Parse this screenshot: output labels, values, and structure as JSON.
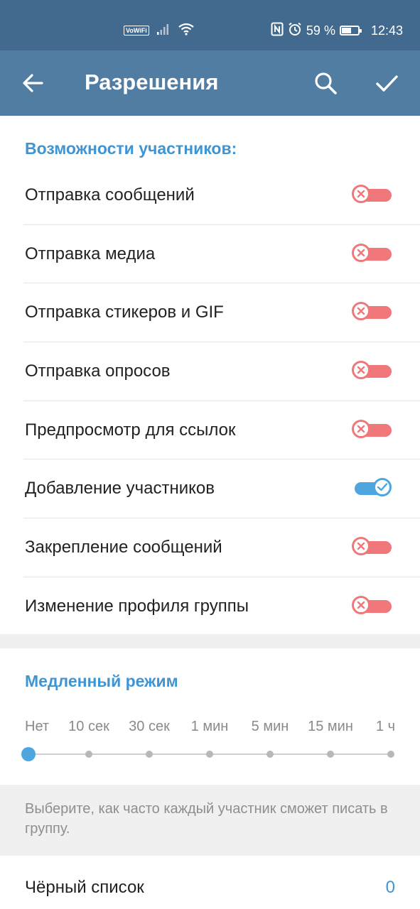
{
  "status_bar": {
    "wifi_badge": "VoWiFi",
    "battery_percent": "59 %",
    "battery_level": 0.59,
    "time": "12:43",
    "icons": [
      "signal-icon",
      "wifi-icon",
      "nfc-icon",
      "alarm-icon",
      "battery-icon"
    ]
  },
  "app_bar": {
    "title": "Разрешения",
    "icons": [
      "back-arrow-icon",
      "search-icon",
      "checkmark-icon"
    ]
  },
  "permissions": {
    "header": "Возможности участников:",
    "items": [
      {
        "label": "Отправка сообщений",
        "enabled": false
      },
      {
        "label": "Отправка медиа",
        "enabled": false
      },
      {
        "label": "Отправка стикеров и GIF",
        "enabled": false
      },
      {
        "label": "Отправка опросов",
        "enabled": false
      },
      {
        "label": "Предпросмотр для ссылок",
        "enabled": false
      },
      {
        "label": "Добавление участников",
        "enabled": true
      },
      {
        "label": "Закрепление сообщений",
        "enabled": false
      },
      {
        "label": "Изменение профиля группы",
        "enabled": false
      }
    ]
  },
  "slow_mode": {
    "header": "Медленный режим",
    "options": [
      "Нет",
      "10 сек",
      "30 сек",
      "1 мин",
      "5 мин",
      "15 мин",
      "1 ч"
    ],
    "selected_index": 0,
    "hint": "Выберите, как часто каждый участник сможет писать в группу."
  },
  "blacklist": {
    "label": "Чёрный список",
    "count": "0"
  },
  "colors": {
    "status_bar": "#426a8e",
    "app_bar": "#517da2",
    "accent": "#3f95d3",
    "toggle_off": "#f0787a",
    "toggle_on": "#4ea6df"
  }
}
